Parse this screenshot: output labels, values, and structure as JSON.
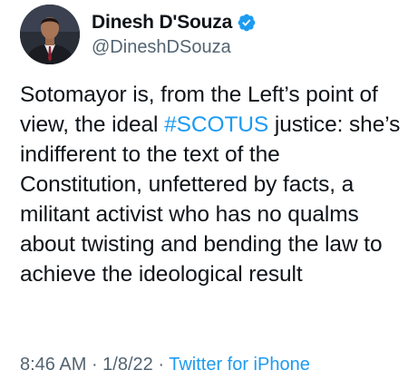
{
  "author": {
    "display_name": "Dinesh D'Souza",
    "handle": "@DineshDSouza",
    "verified": true,
    "avatar_icon": "profile-photo-man-in-suit"
  },
  "tweet": {
    "text_before": "Sotomayor is, from the Left’s point of view, the ideal ",
    "hashtag": "#SCOTUS",
    "text_after": " justice: she’s indifferent to the text of the Constitution, unfettered by facts, a militant activist who has no qualms about twisting and bending the law to achieve the ideological result"
  },
  "meta": {
    "time": "8:46 AM",
    "separator_1": " · ",
    "date": "1/8/22",
    "separator_2": " · ",
    "source": "Twitter for iPhone"
  },
  "colors": {
    "link": "#1d9bf0",
    "secondary_text": "#536471",
    "primary_text": "#0f1419",
    "verified_badge": "#1d9bf0"
  }
}
